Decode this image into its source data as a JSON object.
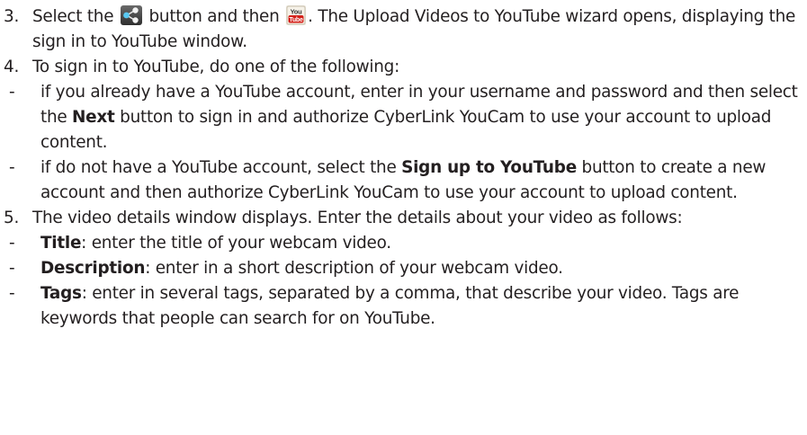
{
  "steps": [
    {
      "number": "3.",
      "text_1": "Select the",
      "text_2": "button and then",
      "text_3": ". The Upload Videos to YouTube wizard opens, displaying the sign in to YouTube window.",
      "icons": {
        "share": "share-icon",
        "youtube": "youtube-icon",
        "youtube_text_top": "You",
        "youtube_text_bottom": "Tube"
      }
    },
    {
      "number": "4.",
      "text": "To sign in to YouTube, do one of the following:",
      "subitems": [
        {
          "dash": "-",
          "pre": "if you already have a YouTube account, enter in your username and password and then select the ",
          "bold": "Next",
          "post": " button to sign in and authorize CyberLink YouCam to use your account to upload content."
        },
        {
          "dash": "-",
          "pre": "if do not have a YouTube account, select the ",
          "bold": "Sign up to YouTube",
          "post": " button to create a new account and then authorize CyberLink YouCam to use your account to upload content."
        }
      ]
    },
    {
      "number": "5.",
      "text": "The video details window displays. Enter the details about your video as follows:",
      "subitems": [
        {
          "dash": "-",
          "bold": "Title",
          "post": ": enter the title of your webcam video."
        },
        {
          "dash": "-",
          "bold": "Description",
          "post": ": enter in a short description of your webcam video."
        },
        {
          "dash": "-",
          "bold": "Tags",
          "post": ": enter in several tags, separated by a comma, that describe your video. Tags are keywords that people can search for on YouTube."
        }
      ]
    }
  ]
}
